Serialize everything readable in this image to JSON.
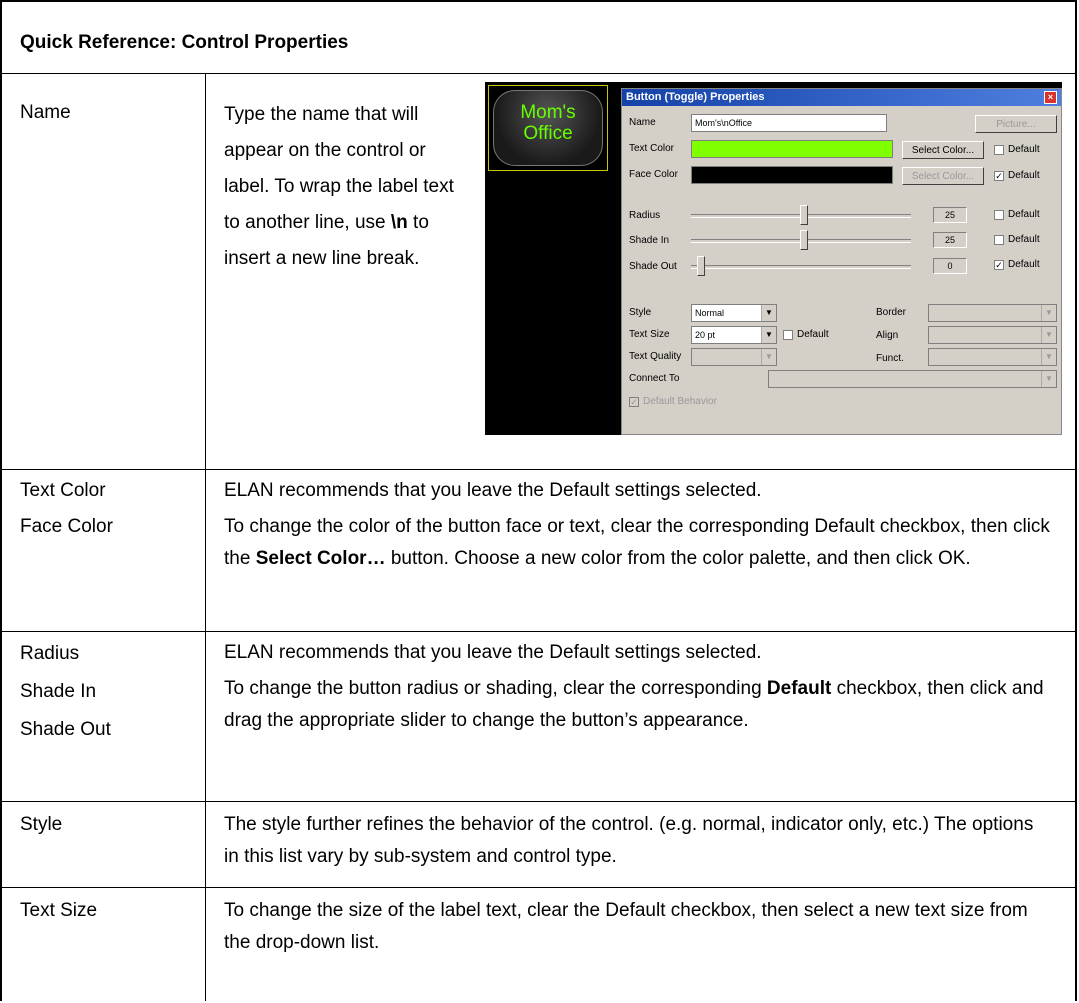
{
  "header": {
    "title": "Quick Reference: Control Properties"
  },
  "rows": [
    {
      "labels": [
        "Name"
      ],
      "paragraphs": [
        "Type the name that will appear on the control or label. To wrap the label text to another line, use ",
        "\\n",
        " to insert a new line break."
      ]
    },
    {
      "labels": [
        "Text Color",
        "Face Color"
      ],
      "p1": "ELAN recommends that you leave the Default settings selected.",
      "p2a": "To change the color of the button face or text, clear the corresponding Default checkbox, then click the ",
      "p2b": "Select Color…",
      "p2c": " button.  Choose a new color from the color palette, and then click OK."
    },
    {
      "labels": [
        "Radius",
        "Shade In",
        "Shade Out"
      ],
      "p1": "ELAN recommends that you leave the Default settings selected.",
      "p2a": "To change the button radius or shading, clear the corresponding ",
      "p2b": "Default",
      "p2c": " checkbox, then click and drag the appropriate slider to change the button’s appearance."
    },
    {
      "labels": [
        "Style"
      ],
      "p1": "The style further refines the behavior of the control. (e.g. normal, indicator only, etc.) The options in this list vary by sub-system and control type."
    },
    {
      "labels": [
        "Text Size"
      ],
      "p1": "To change the size of the label text, clear the Default checkbox, then select a new text size from the drop-down list."
    }
  ],
  "preview": {
    "line1": "Mom's",
    "line2": "Office",
    "text_color": "#66ff00"
  },
  "dialog": {
    "title": "Button (Toggle) Properties",
    "name_label": "Name",
    "name_value": "Mom's\\nOffice",
    "picture_button": "Picture...",
    "text_color_label": "Text Color",
    "text_color_swatch": "#80ff00",
    "face_color_label": "Face Color",
    "face_color_swatch": "#000000",
    "select_color_button": "Select Color...",
    "default_label": "Default",
    "radius_label": "Radius",
    "radius_value": "25",
    "shade_in_label": "Shade In",
    "shade_in_value": "25",
    "shade_out_label": "Shade Out",
    "shade_out_value": "0",
    "style_label": "Style",
    "style_value": "Normal",
    "text_size_label": "Text Size",
    "text_size_value": "20 pt",
    "text_quality_label": "Text Quality",
    "connect_to_label": "Connect To",
    "border_label": "Border",
    "align_label": "Align",
    "funct_label": "Funct.",
    "default_behavior_label": "Default Behavior"
  }
}
